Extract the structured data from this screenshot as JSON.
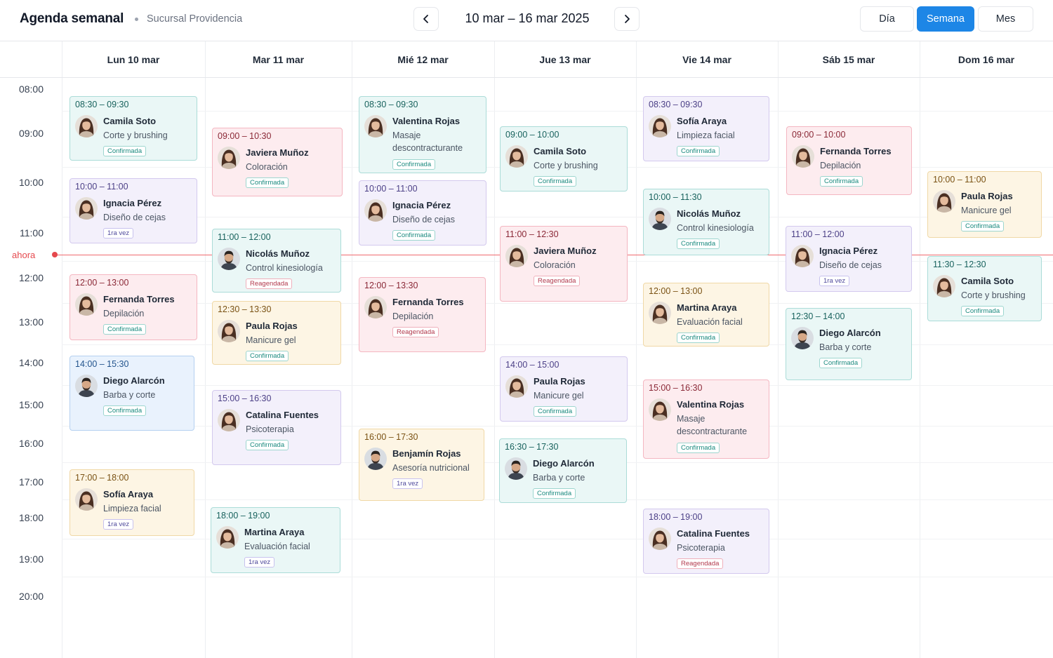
{
  "header": {
    "title": "Agenda semanal",
    "branch": "Sucursal Providencia",
    "date_range": "10 mar – 16 mar 2025",
    "views": [
      {
        "label": "Día",
        "active": false
      },
      {
        "label": "Semana",
        "active": true
      },
      {
        "label": "Mes",
        "active": false
      }
    ]
  },
  "days": [
    "Lun 10 mar",
    "Mar 11 mar",
    "Mié 12 mar",
    "Jue 13 mar",
    "Vie 14 mar",
    "Sáb 15 mar",
    "Dom 16 mar"
  ],
  "hours": [
    "08:00",
    "09:00",
    "10:00",
    "11:00",
    "12:00",
    "13:00",
    "14:00",
    "15:00",
    "16:00",
    "17:00",
    "18:00",
    "19:00",
    "20:00"
  ],
  "now_label": "ahora",
  "colors": {
    "accent": "#1d86e6",
    "now_line": "#e5484d",
    "teal": "#eaf7f6",
    "purple": "#f3f0fb",
    "pink": "#fdecef",
    "blue": "#e9f2fd",
    "yellow": "#fdf5e4"
  },
  "events": [
    {
      "day": 0,
      "time": "08:30 – 09:30",
      "name": "Camila Soto",
      "service": "Corte y brushing",
      "status": "Confirmada",
      "color": "teal",
      "gender": "f"
    },
    {
      "day": 0,
      "time": "10:00 – 11:00",
      "name": "Ignacia Pérez",
      "service": "Diseño de cejas",
      "status": "1ra vez",
      "color": "purple",
      "gender": "f"
    },
    {
      "day": 0,
      "time": "12:00 – 13:00",
      "name": "Fernanda Torres",
      "service": "Depilación",
      "status": "Confirmada",
      "color": "pink",
      "gender": "f"
    },
    {
      "day": 0,
      "time": "14:00 – 15:30",
      "name": "Diego Alarcón",
      "service": "Barba y corte",
      "status": "Confirmada",
      "color": "blue",
      "gender": "m"
    },
    {
      "day": 0,
      "time": "17:00 – 18:00",
      "name": "Sofía Araya",
      "service": "Limpieza facial",
      "status": "1ra vez",
      "color": "yellow",
      "gender": "f"
    },
    {
      "day": 1,
      "time": "09:00 – 10:30",
      "name": "Javiera Muñoz",
      "service": "Coloración",
      "status": "Confirmada",
      "color": "pink",
      "gender": "f"
    },
    {
      "day": 1,
      "time": "11:00 – 12:00",
      "name": "Nicolás Muñoz",
      "service": "Control kinesiología",
      "status": "Reagendada",
      "color": "teal",
      "gender": "m"
    },
    {
      "day": 1,
      "time": "12:30 – 13:30",
      "name": "Paula Rojas",
      "service": "Manicure gel",
      "status": "Confirmada",
      "color": "yellow",
      "gender": "f"
    },
    {
      "day": 1,
      "time": "15:00 – 16:30",
      "name": "Catalina Fuentes",
      "service": "Psicoterapia",
      "status": "Confirmada",
      "color": "purple",
      "gender": "f"
    },
    {
      "day": 1,
      "time": "18:00 – 19:00",
      "name": "Martina Araya",
      "service": "Evaluación facial",
      "status": "1ra vez",
      "color": "teal",
      "gender": "f"
    },
    {
      "day": 2,
      "time": "08:30 – 09:30",
      "name": "Valentina Rojas",
      "service": "Masaje descontracturante",
      "status": "Confirmada",
      "color": "teal",
      "gender": "f"
    },
    {
      "day": 2,
      "time": "10:00 – 11:00",
      "name": "Ignacia Pérez",
      "service": "Diseño de cejas",
      "status": "Confirmada",
      "color": "purple",
      "gender": "f"
    },
    {
      "day": 2,
      "time": "12:00 – 13:30",
      "name": "Fernanda Torres",
      "service": "Depilación",
      "status": "Reagendada",
      "color": "pink",
      "gender": "f"
    },
    {
      "day": 2,
      "time": "16:00 – 17:30",
      "name": "Benjamín Rojas",
      "service": "Asesoría nutricional",
      "status": "1ra vez",
      "color": "yellow",
      "gender": "m"
    },
    {
      "day": 3,
      "time": "09:00 – 10:00",
      "name": "Camila Soto",
      "service": "Corte y brushing",
      "status": "Confirmada",
      "color": "teal",
      "gender": "f"
    },
    {
      "day": 3,
      "time": "11:00 – 12:30",
      "name": "Javiera Muñoz",
      "service": "Coloración",
      "status": "Reagendada",
      "color": "pink",
      "gender": "f"
    },
    {
      "day": 3,
      "time": "14:00 – 15:00",
      "name": "Paula Rojas",
      "service": "Manicure gel",
      "status": "Confirmada",
      "color": "purple",
      "gender": "f"
    },
    {
      "day": 3,
      "time": "16:30 – 17:30",
      "name": "Diego Alarcón",
      "service": "Barba y corte",
      "status": "Confirmada",
      "color": "teal",
      "gender": "m"
    },
    {
      "day": 4,
      "time": "08:30 – 09:30",
      "name": "Sofía Araya",
      "service": "Limpieza facial",
      "status": "Confirmada",
      "color": "purple",
      "gender": "f"
    },
    {
      "day": 4,
      "time": "10:00 – 11:30",
      "name": "Nicolás Muñoz",
      "service": "Control kinesiología",
      "status": "Confirmada",
      "color": "teal",
      "gender": "m"
    },
    {
      "day": 4,
      "time": "12:00 – 13:00",
      "name": "Martina Araya",
      "service": "Evaluación facial",
      "status": "Confirmada",
      "color": "yellow",
      "gender": "f"
    },
    {
      "day": 4,
      "time": "15:00 – 16:30",
      "name": "Valentina Rojas",
      "service": "Masaje descontracturante",
      "status": "Confirmada",
      "color": "pink",
      "gender": "f"
    },
    {
      "day": 4,
      "time": "18:00 – 19:00",
      "name": "Catalina Fuentes",
      "service": "Psicoterapia",
      "status": "Reagendada",
      "color": "purple",
      "gender": "f"
    },
    {
      "day": 5,
      "time": "09:00 – 10:00",
      "name": "Fernanda Torres",
      "service": "Depilación",
      "status": "Confirmada",
      "color": "pink",
      "gender": "f"
    },
    {
      "day": 5,
      "time": "11:00 – 12:00",
      "name": "Ignacia Pérez",
      "service": "Diseño de cejas",
      "status": "1ra vez",
      "color": "purple",
      "gender": "f"
    },
    {
      "day": 5,
      "time": "12:30 – 14:00",
      "name": "Diego Alarcón",
      "service": "Barba y corte",
      "status": "Confirmada",
      "color": "teal",
      "gender": "m"
    },
    {
      "day": 6,
      "time": "10:00 – 11:00",
      "name": "Paula Rojas",
      "service": "Manicure gel",
      "status": "Confirmada",
      "color": "yellow",
      "gender": "f"
    },
    {
      "day": 6,
      "time": "11:30 – 12:30",
      "name": "Camila Soto",
      "service": "Corte y brushing",
      "status": "Confirmada",
      "color": "teal",
      "gender": "f"
    }
  ]
}
